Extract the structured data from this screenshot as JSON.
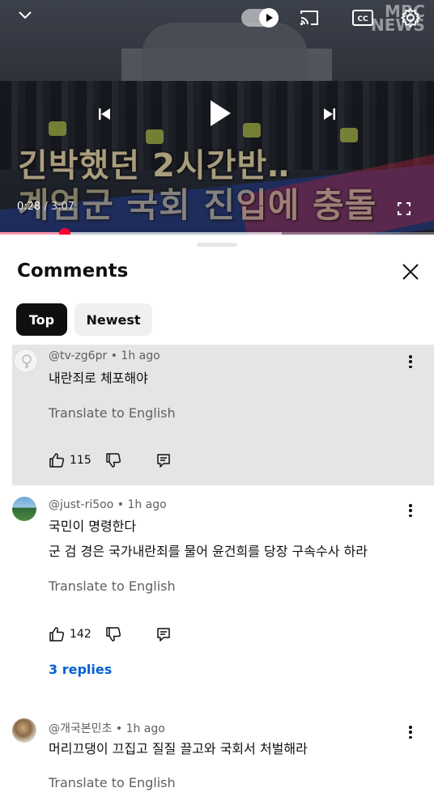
{
  "player": {
    "caption_line1": "긴박했던 2시간반‥",
    "caption_line2": "계엄군 국회 진입에 충돌",
    "logo_text_top": "MBC",
    "logo_text_bottom": "NEWS",
    "current_time": "0:28",
    "separator": " / ",
    "duration": "3:07",
    "progress_fraction": 0.15,
    "buffer_fraction": 0.65,
    "autoplay_on": true
  },
  "sheet": {
    "title": "Comments",
    "filters": [
      {
        "label": "Top",
        "active": true
      },
      {
        "label": "Newest",
        "active": false
      }
    ]
  },
  "comments": [
    {
      "handle": "@tv-zg6pr",
      "time": "1h ago",
      "lines": [
        "내란죄로 체포해야"
      ],
      "translate": "Translate to English",
      "likes": "115",
      "highlighted": true
    },
    {
      "handle": "@just-ri5oo",
      "time": "1h ago",
      "lines": [
        "국민이 명령한다",
        "군 검 경은 국가내란죄를 물어 윤건희를 당장 구속수사 하라"
      ],
      "translate": "Translate to English",
      "likes": "142",
      "replies": "3 replies",
      "highlighted": false
    },
    {
      "handle": "@개국본민초",
      "time": "1h ago",
      "lines": [
        "머리끄댕이 끄집고 질질 끌고와 국회서 처벌해라"
      ],
      "translate": "Translate to English",
      "highlighted": false
    }
  ],
  "meta_separator": " • ",
  "colors": {
    "accent_red": "#ff0033",
    "link_blue": "#065fd4",
    "highlight_gray": "#e5e5e5"
  },
  "icons": [
    "chevron-down-icon",
    "autoplay-toggle-icon",
    "cast-icon",
    "captions-icon",
    "settings-icon",
    "previous-icon",
    "play-icon",
    "next-icon",
    "fullscreen-icon",
    "close-icon",
    "like-icon",
    "dislike-icon",
    "reply-icon",
    "more-options-icon"
  ]
}
